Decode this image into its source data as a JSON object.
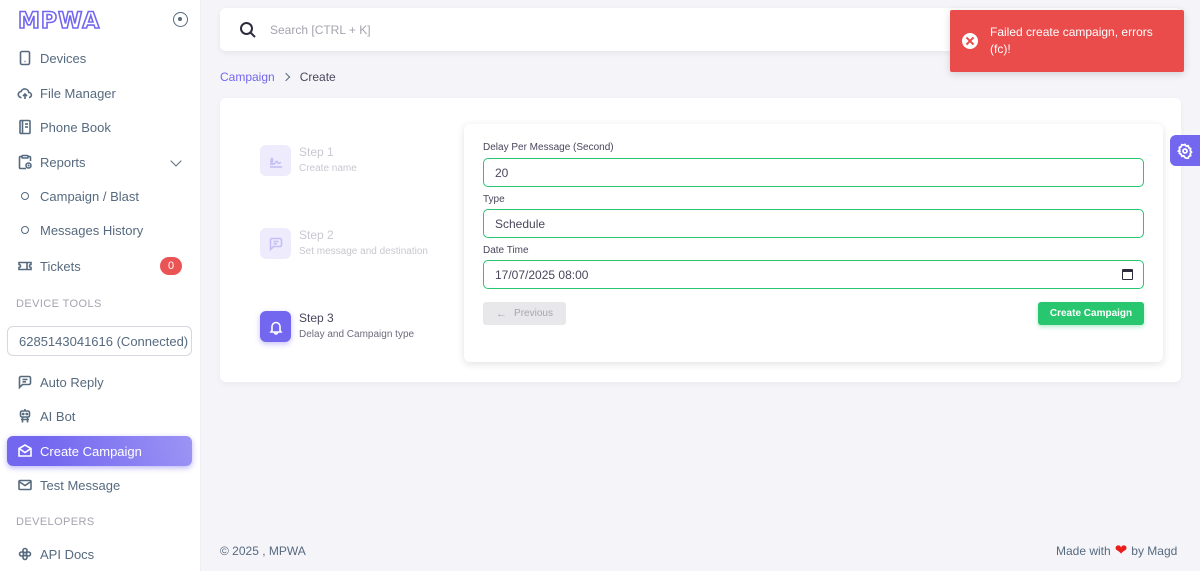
{
  "brand": {
    "logo": "MPWA"
  },
  "sidebar": {
    "items": [
      {
        "label": "Devices",
        "icon": "device-mobile-icon"
      },
      {
        "label": "File Manager",
        "icon": "cloud-upload-icon"
      },
      {
        "label": "Phone Book",
        "icon": "address-book-icon"
      },
      {
        "label": "Reports",
        "icon": "report-icon"
      },
      {
        "label": "Campaign / Blast",
        "icon": "circle-icon"
      },
      {
        "label": "Messages History",
        "icon": "circle-icon"
      },
      {
        "label": "Tickets",
        "icon": "ticket-icon",
        "badge": "0"
      }
    ],
    "device_tools_header": "DEVICE TOOLS",
    "device_select": "6285143041616 (Connected)",
    "tools": [
      {
        "label": "Auto Reply",
        "icon": "message-icon"
      },
      {
        "label": "AI Bot",
        "icon": "robot-icon"
      },
      {
        "label": "Create Campaign",
        "icon": "mail-opened-icon",
        "active": true
      },
      {
        "label": "Test Message",
        "icon": "mail-icon"
      }
    ],
    "developers_header": "DEVELOPERS",
    "dev_items": [
      {
        "label": "API Docs",
        "icon": "api-icon"
      }
    ]
  },
  "search": {
    "placeholder": "Search [CTRL + K]"
  },
  "toast": {
    "message": "Failed create campaign, errors (fc)!",
    "color": "#ea4b4b"
  },
  "breadcrumb": {
    "parent": "Campaign",
    "current": "Create"
  },
  "steps": [
    {
      "title": "Step 1",
      "subtitle": "Create name",
      "state": "muted"
    },
    {
      "title": "Step 2",
      "subtitle": "Set message and destination",
      "state": "muted"
    },
    {
      "title": "Step 3",
      "subtitle": "Delay and Campaign type",
      "state": "active"
    }
  ],
  "form": {
    "delay_label": "Delay Per Message (Second)",
    "delay_value": "20",
    "type_label": "Type",
    "type_value": "Schedule",
    "datetime_label": "Date Time",
    "datetime_value": "17/07/2025 08:00",
    "previous_label": "Previous",
    "create_label": "Create Campaign"
  },
  "footer": {
    "copyright": "© 2025 , MPWA",
    "made_with": "Made with",
    "by": "by Magd"
  },
  "colors": {
    "primary": "#7367f0",
    "success": "#28c76f",
    "danger": "#ea5455"
  }
}
